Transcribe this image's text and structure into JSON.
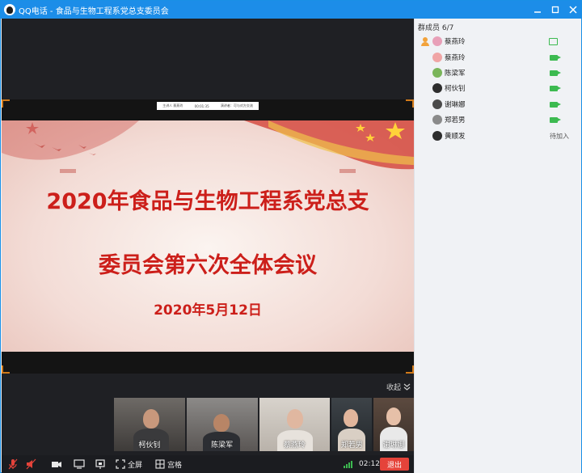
{
  "window": {
    "title": "QQ电话 - 食品与生物工程系党总支委员会",
    "controls": [
      "minimize-icon",
      "maximize-icon",
      "close-icon"
    ]
  },
  "share": {
    "bar_items": [
      "主讲人 蔡燕玲",
      "00:01:35",
      "演讲者：可与对方交流"
    ],
    "slide": {
      "title_line1": "2020年食品与生物工程系党总支",
      "title_line2": "委员会第六次全体会议",
      "date": "2020年5月12日"
    }
  },
  "video_strip": {
    "collapse_label": "收起",
    "participants": [
      {
        "name": "柯伙钊"
      },
      {
        "name": "陈梁军"
      },
      {
        "name": "蔡燕玲"
      },
      {
        "name": "郑若男"
      },
      {
        "name": "谢琳娜"
      }
    ]
  },
  "toolbar": {
    "fullscreen_label": "全屏",
    "grid_label": "宫格",
    "timer": "02:12",
    "hangup_label": "退出"
  },
  "sidebar": {
    "title": "群成员 6/7",
    "members": [
      {
        "name": "蔡燕玲",
        "status": "",
        "role": "host"
      },
      {
        "name": "蔡燕玲",
        "status": ""
      },
      {
        "name": "陈梁军",
        "status": ""
      },
      {
        "name": "柯伙钊",
        "status": ""
      },
      {
        "name": "谢琳娜",
        "status": ""
      },
      {
        "name": "郑若男",
        "status": ""
      },
      {
        "name": "黄顺发",
        "status": "待加入"
      }
    ]
  },
  "colors": {
    "titlebar": "#1c8de8",
    "slide_text": "#cc1f1a",
    "camera_on": "#3cba50",
    "hangup": "#e5433a"
  }
}
